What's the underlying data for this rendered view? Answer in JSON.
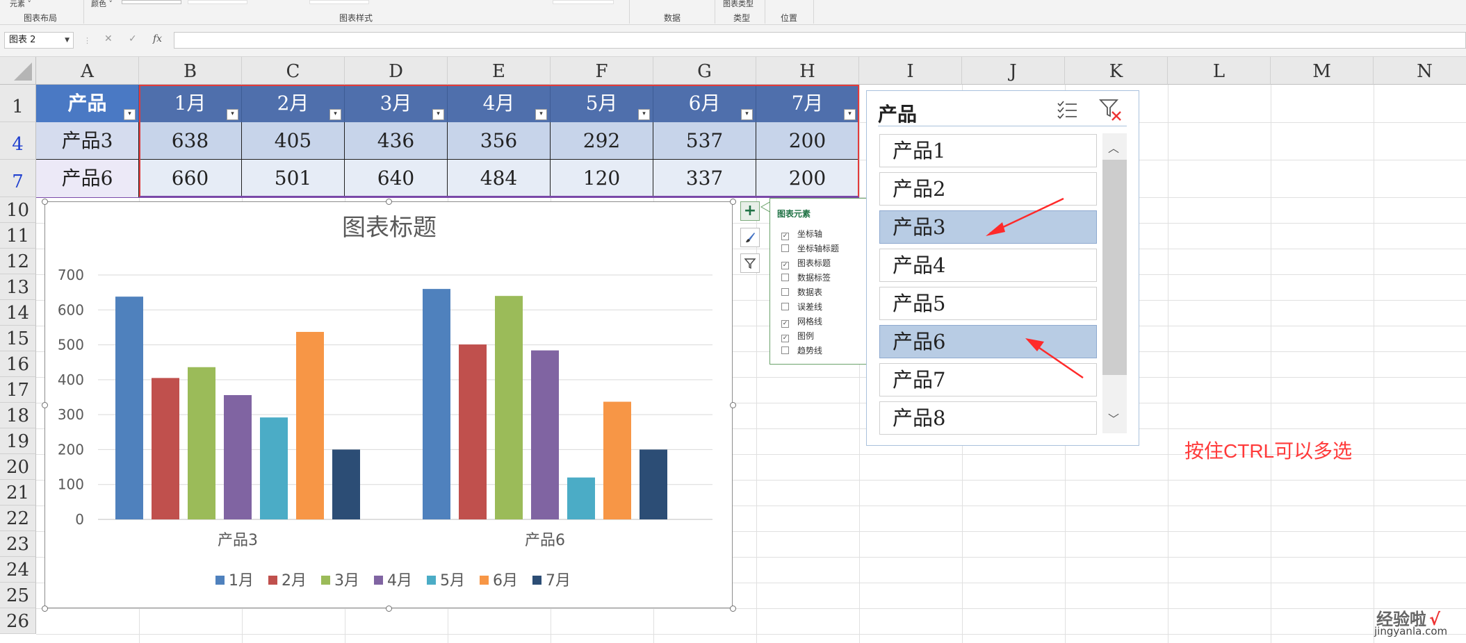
{
  "ribbon": {
    "top_left_items": [
      "元素 ˅",
      "颜色 ˅"
    ],
    "groups": [
      "图表布局",
      "图表样式",
      "数据",
      "类型",
      "位置"
    ],
    "type_top_label": "图表类型"
  },
  "formula_bar": {
    "name_box": "图表 2",
    "cancel": "✕",
    "confirm": "✓",
    "fx": "fx",
    "value": ""
  },
  "columns": [
    "A",
    "B",
    "C",
    "D",
    "E",
    "F",
    "G",
    "H",
    "I",
    "J",
    "K",
    "L",
    "M",
    "N"
  ],
  "rows": [
    "1",
    "4",
    "7",
    "10",
    "11",
    "12",
    "13",
    "14",
    "15",
    "16",
    "17",
    "18",
    "19",
    "20",
    "21",
    "22",
    "23",
    "24",
    "25",
    "26"
  ],
  "table": {
    "headers": [
      "产品",
      "1月",
      "2月",
      "3月",
      "4月",
      "5月",
      "6月",
      "7月"
    ],
    "rows": [
      [
        "产品3",
        "638",
        "405",
        "436",
        "356",
        "292",
        "537",
        "200"
      ],
      [
        "产品6",
        "660",
        "501",
        "640",
        "484",
        "120",
        "337",
        "200"
      ]
    ]
  },
  "chart_data": {
    "type": "bar",
    "title": "图表标题",
    "categories": [
      "产品3",
      "产品6"
    ],
    "series": [
      {
        "name": "1月",
        "values": [
          638,
          660
        ],
        "color": "#4f81bd"
      },
      {
        "name": "2月",
        "values": [
          405,
          501
        ],
        "color": "#c0504d"
      },
      {
        "name": "3月",
        "values": [
          436,
          640
        ],
        "color": "#9bbb59"
      },
      {
        "name": "4月",
        "values": [
          356,
          484
        ],
        "color": "#8064a2"
      },
      {
        "name": "5月",
        "values": [
          292,
          120
        ],
        "color": "#4bacc6"
      },
      {
        "name": "6月",
        "values": [
          537,
          337
        ],
        "color": "#f79646"
      },
      {
        "name": "7月",
        "values": [
          200,
          200
        ],
        "color": "#2c4d75"
      }
    ],
    "ylim": [
      0,
      700
    ],
    "yticks": [
      "0",
      "100",
      "200",
      "300",
      "400",
      "500",
      "600",
      "700"
    ],
    "grid": true,
    "legend": "bottom"
  },
  "chart_elements": {
    "title": "图表元素",
    "items": [
      {
        "label": "坐标轴",
        "checked": true
      },
      {
        "label": "坐标轴标题",
        "checked": false
      },
      {
        "label": "图表标题",
        "checked": true
      },
      {
        "label": "数据标签",
        "checked": false
      },
      {
        "label": "数据表",
        "checked": false
      },
      {
        "label": "误差线",
        "checked": false
      },
      {
        "label": "网格线",
        "checked": true
      },
      {
        "label": "图例",
        "checked": true
      },
      {
        "label": "趋势线",
        "checked": false
      }
    ]
  },
  "slicer": {
    "title": "产品",
    "items": [
      {
        "label": "产品1",
        "selected": false
      },
      {
        "label": "产品2",
        "selected": false
      },
      {
        "label": "产品3",
        "selected": true
      },
      {
        "label": "产品4",
        "selected": false
      },
      {
        "label": "产品5",
        "selected": false
      },
      {
        "label": "产品6",
        "selected": true
      },
      {
        "label": "产品7",
        "selected": false
      },
      {
        "label": "产品8",
        "selected": false
      }
    ]
  },
  "note": "按住CTRL可以多选",
  "watermark": {
    "title": "经验啦",
    "check": "√",
    "url": "jingyanla.com"
  },
  "colors": {
    "accent": "#ff3a3a",
    "header": "#4f6fac",
    "selected": "#b8cce4"
  }
}
